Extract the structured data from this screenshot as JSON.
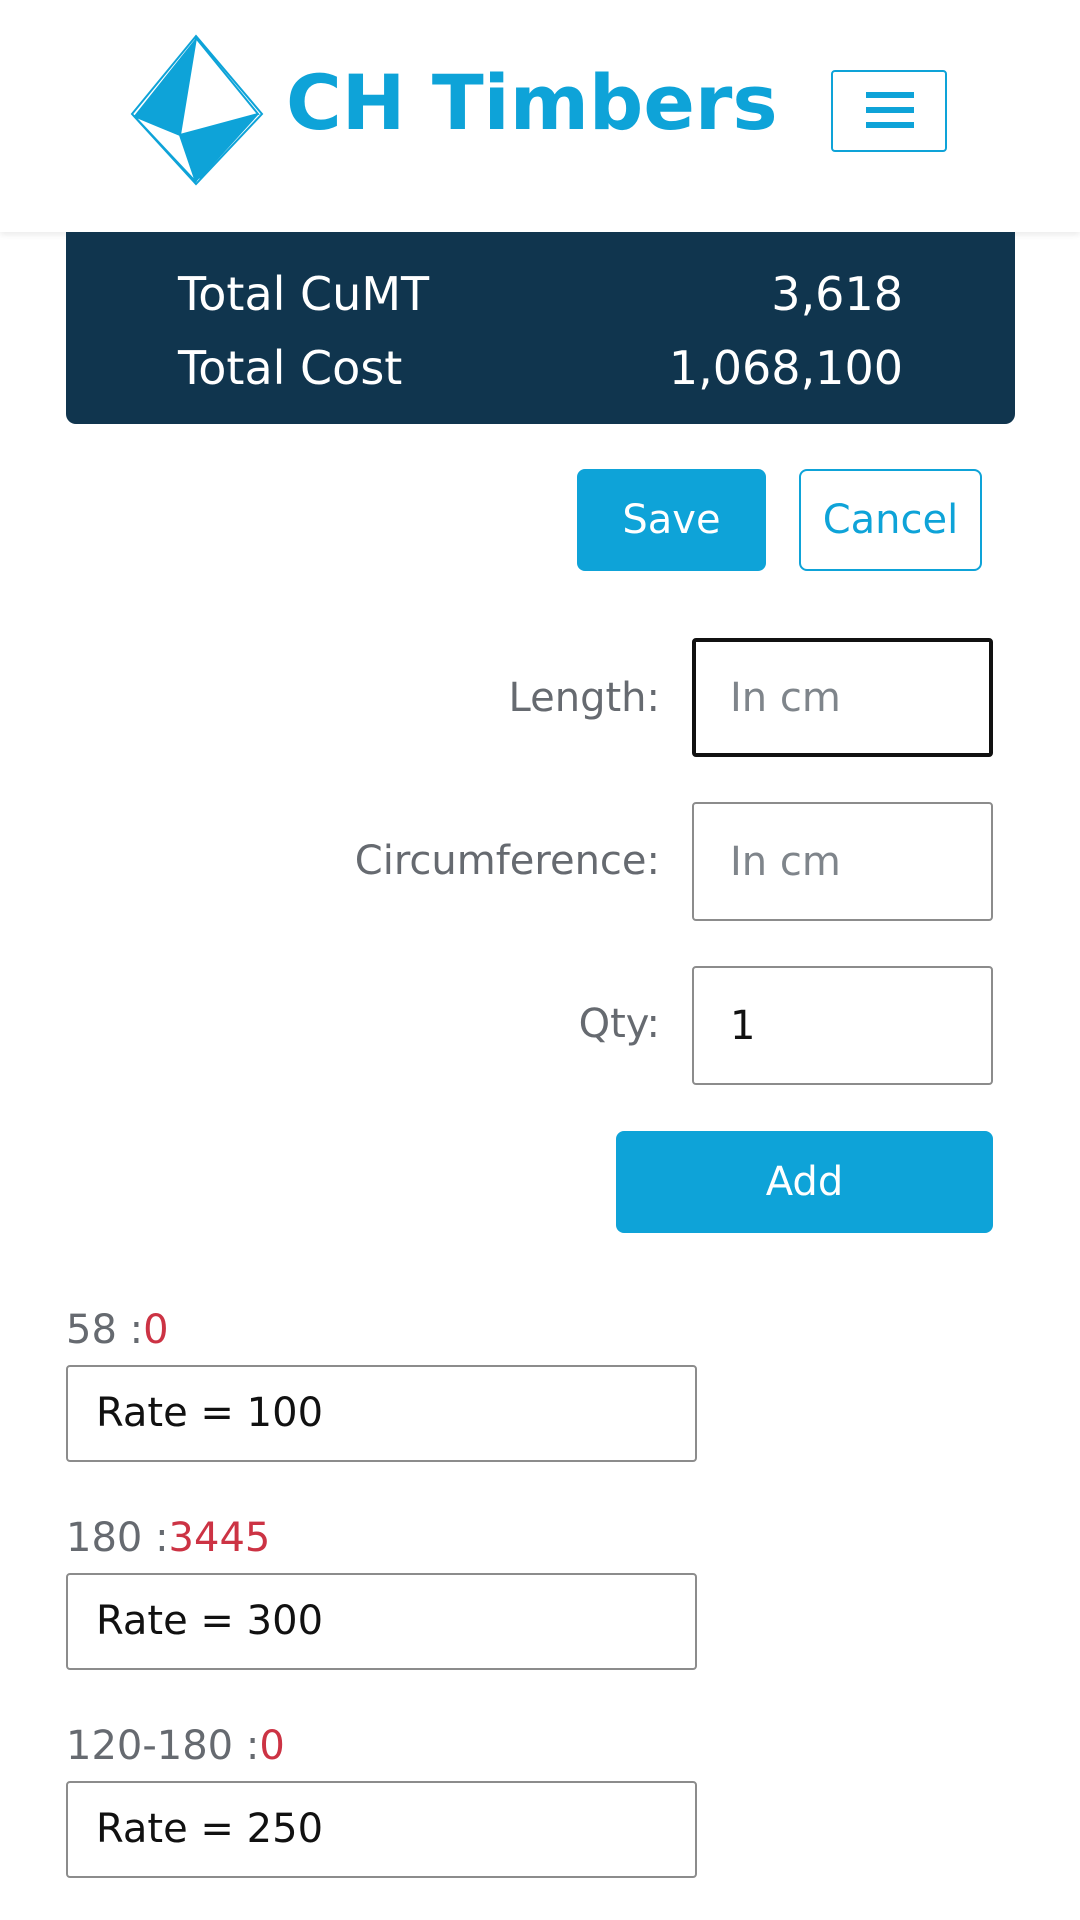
{
  "header": {
    "brand": "CH Timbers",
    "logo_icon": "diamond-logo-icon",
    "menu_icon": "hamburger-menu-icon",
    "accent_color": "#0ea3d8"
  },
  "totals": {
    "background_color": "#10354e",
    "rows": [
      {
        "label": "Total CuMT",
        "value": "3,618"
      },
      {
        "label": "Total Cost",
        "value": "1,068,100"
      }
    ]
  },
  "actions": {
    "save_label": "Save",
    "cancel_label": "Cancel"
  },
  "form": {
    "length_label": "Length:",
    "length_value": "",
    "length_placeholder": "In cm",
    "circumference_label": "Circumference:",
    "circumference_value": "",
    "circumference_placeholder": "In cm",
    "qty_label": "Qty:",
    "qty_value": "1",
    "add_label": "Add"
  },
  "rates": [
    {
      "key": "58 :",
      "value": "0",
      "rate": "Rate = 100"
    },
    {
      "key": "180 :",
      "value": "3445",
      "rate": "Rate = 300"
    },
    {
      "key": "120-180 :",
      "value": "0",
      "rate": "Rate = 250"
    }
  ],
  "colors": {
    "value_highlight": "#cc3344",
    "label_gray": "#666a70"
  }
}
